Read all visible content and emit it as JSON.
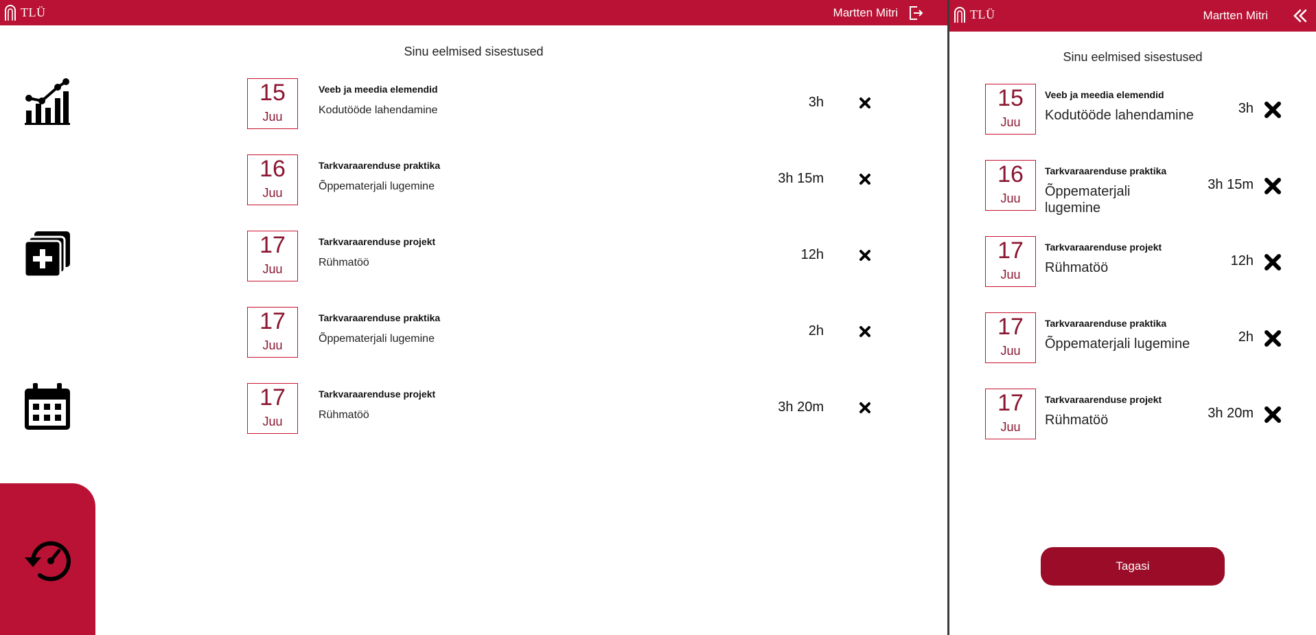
{
  "brand": {
    "name": "TLÜ"
  },
  "user": {
    "name": "Martten Mitri"
  },
  "page": {
    "heading": "Sinu eelmised sisestused"
  },
  "entries": [
    {
      "day": "15",
      "month": "Juu",
      "course": "Veeb ja meedia elemendid",
      "task": "Kodutööde lahendamine",
      "duration": "3h"
    },
    {
      "day": "16",
      "month": "Juu",
      "course": "Tarkvaraarenduse praktika",
      "task": "Õppematerjali lugemine",
      "duration": "3h 15m"
    },
    {
      "day": "17",
      "month": "Juu",
      "course": "Tarkvaraarenduse projekt",
      "task": "Rühmatöö",
      "duration": "12h"
    },
    {
      "day": "17",
      "month": "Juu",
      "course": "Tarkvaraarenduse praktika",
      "task": "Õppematerjali lugemine",
      "duration": "2h"
    },
    {
      "day": "17",
      "month": "Juu",
      "course": "Tarkvaraarenduse projekt",
      "task": "Rühmatöö",
      "duration": "3h 20m"
    }
  ],
  "mobile": {
    "back_label": "Tagasi"
  },
  "icons": {
    "logo": "tlu-arch-logo",
    "logout": "logout-icon",
    "collapse": "double-chevron-left-icon",
    "stats": "chart-icon",
    "add": "add-entry-icon",
    "calendar": "calendar-icon",
    "history": "history-icon",
    "delete": "close-x-icon"
  },
  "colors": {
    "brand": "#b91234",
    "date_border": "#c8102e",
    "date_text": "#8a1630",
    "button": "#9a0c28"
  }
}
